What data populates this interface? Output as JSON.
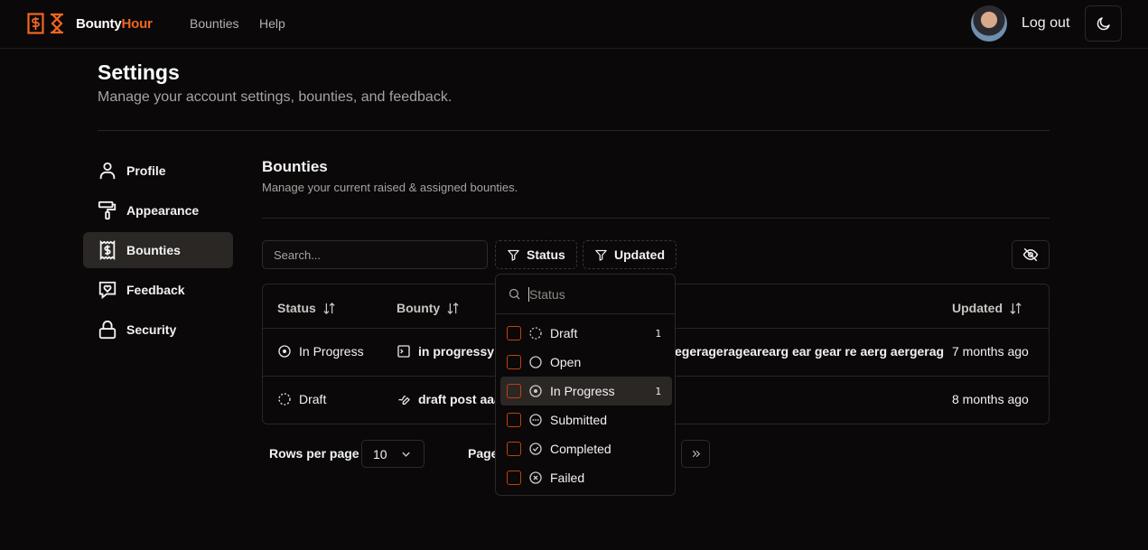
{
  "colors": {
    "accent": "#f26522",
    "background": "#0a0808"
  },
  "header": {
    "brand_part1": "Bounty",
    "brand_part2": "Hour",
    "nav": [
      "Bounties",
      "Help"
    ],
    "logout_label": "Log out"
  },
  "page": {
    "title": "Settings",
    "subtitle": "Manage your account settings, bounties, and feedback."
  },
  "sidebar": {
    "items": [
      {
        "label": "Profile",
        "icon": "user-icon"
      },
      {
        "label": "Appearance",
        "icon": "paint-roller-icon"
      },
      {
        "label": "Bounties",
        "icon": "receipt-dollar-icon",
        "active": true
      },
      {
        "label": "Feedback",
        "icon": "message-heart-icon"
      },
      {
        "label": "Security",
        "icon": "lock-icon"
      }
    ]
  },
  "section": {
    "title": "Bounties",
    "subtitle": "Manage your current raised & assigned bounties."
  },
  "toolbar": {
    "search_placeholder": "Search...",
    "status_filter": "Status",
    "updated_filter": "Updated"
  },
  "table": {
    "columns": [
      "Status",
      "Bounty",
      "Updated"
    ],
    "rows": [
      {
        "status": "In Progress",
        "bounty": "in progressy f",
        "bounty_tail": "egerageragearearg ear gear re aerg aergerag",
        "updated": "7 months ago"
      },
      {
        "status": "Draft",
        "bounty": "draft post aaa",
        "bounty_tail": "",
        "updated": "8 months ago"
      }
    ]
  },
  "pagination": {
    "rows_label": "Rows per page",
    "rows_value": "10",
    "page_label": "Page"
  },
  "status_dropdown": {
    "placeholder": "Status",
    "options": [
      {
        "label": "Draft",
        "count": "1"
      },
      {
        "label": "Open",
        "count": ""
      },
      {
        "label": "In Progress",
        "count": "1"
      },
      {
        "label": "Submitted",
        "count": ""
      },
      {
        "label": "Completed",
        "count": ""
      },
      {
        "label": "Failed",
        "count": ""
      }
    ]
  }
}
